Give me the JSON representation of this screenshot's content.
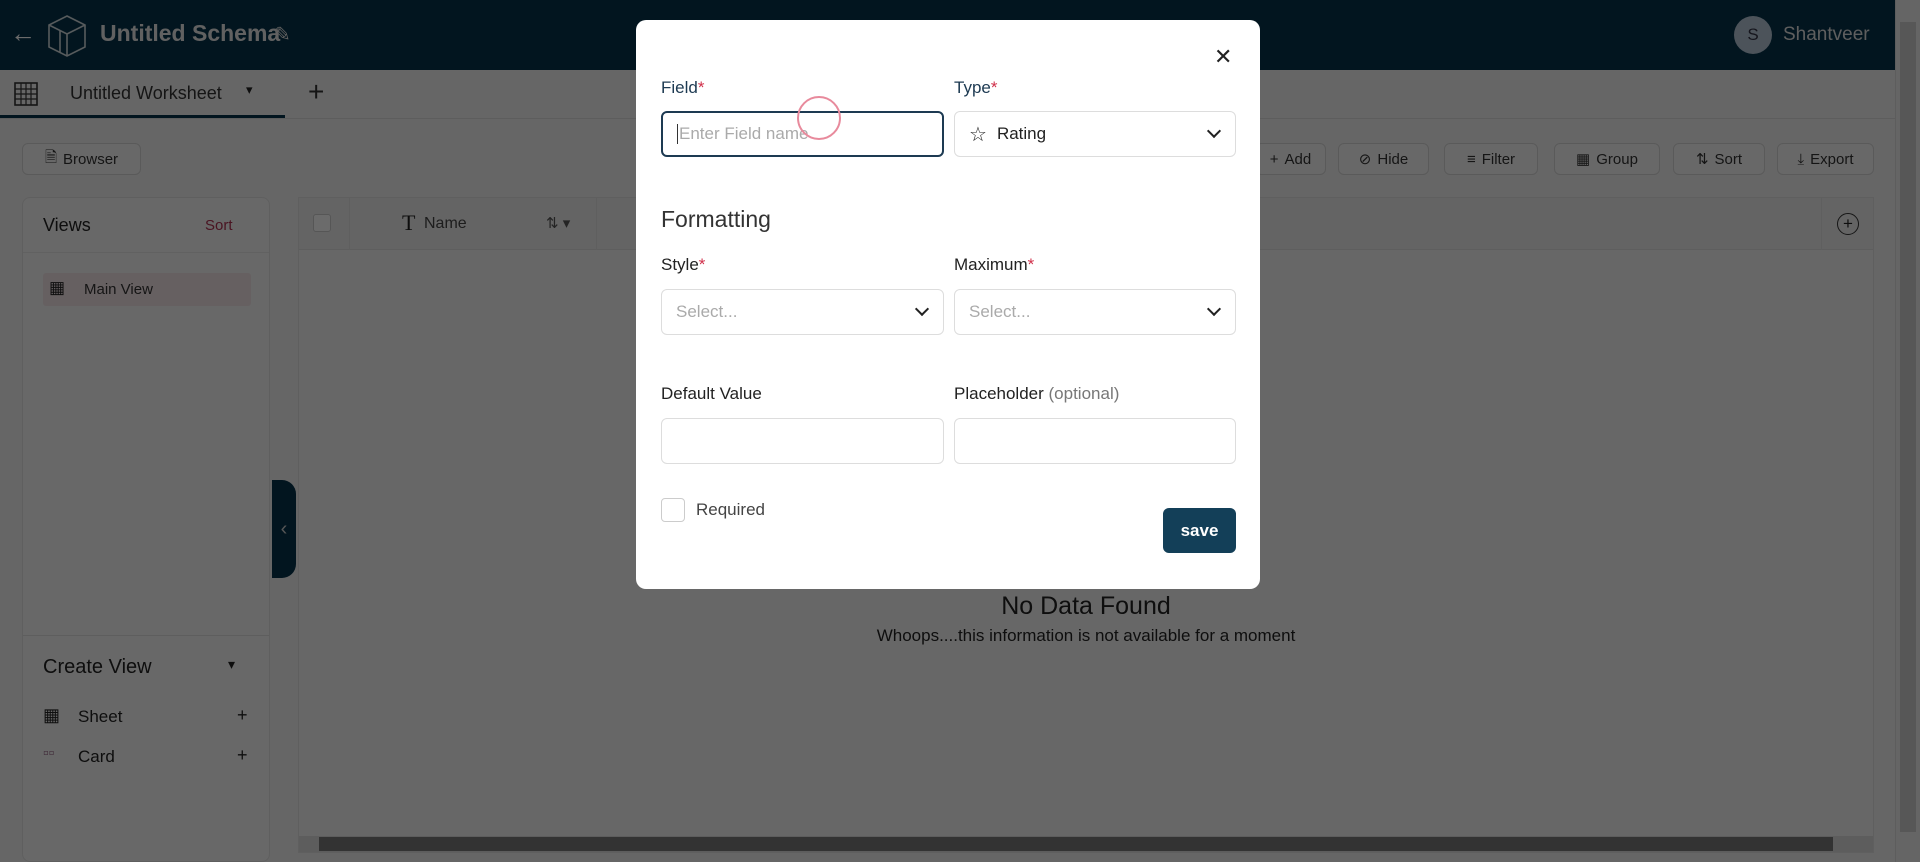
{
  "header": {
    "title": "Untitled Schema",
    "user_initial": "S",
    "user_name": "Shantveer"
  },
  "tabs": {
    "worksheet": "Untitled Worksheet",
    "add": "+"
  },
  "toolbar": {
    "browser": "Browser",
    "add": "Add",
    "hide": "Hide",
    "filter": "Filter",
    "group": "Group",
    "sort": "Sort",
    "export": "Export"
  },
  "views": {
    "title": "Views",
    "sort": "Sort",
    "items": [
      {
        "label": "Main View"
      }
    ]
  },
  "create_view": {
    "title": "Create View",
    "items": [
      {
        "label": "Sheet",
        "add": "+"
      },
      {
        "label": "Card",
        "add": "+"
      }
    ]
  },
  "grid": {
    "columns": [
      {
        "label": "Name"
      }
    ],
    "empty_title": "No Data Found",
    "empty_message": "Whoops....this information is not available for a moment"
  },
  "modal": {
    "field_label": "Field",
    "field_placeholder": "Enter Field name",
    "required_mark": "*",
    "type_label": "Type",
    "type_value": "Rating",
    "formatting": "Formatting",
    "style_label": "Style",
    "style_placeholder": "Select...",
    "maximum_label": "Maximum",
    "maximum_placeholder": "Select...",
    "default_label": "Default Value",
    "placeholder_label": "Placeholder",
    "optional": "(optional)",
    "required_label": "Required",
    "save": "save"
  },
  "colors": {
    "brand": "#04324a",
    "accent": "#d0304a",
    "save_button": "#133f58"
  }
}
